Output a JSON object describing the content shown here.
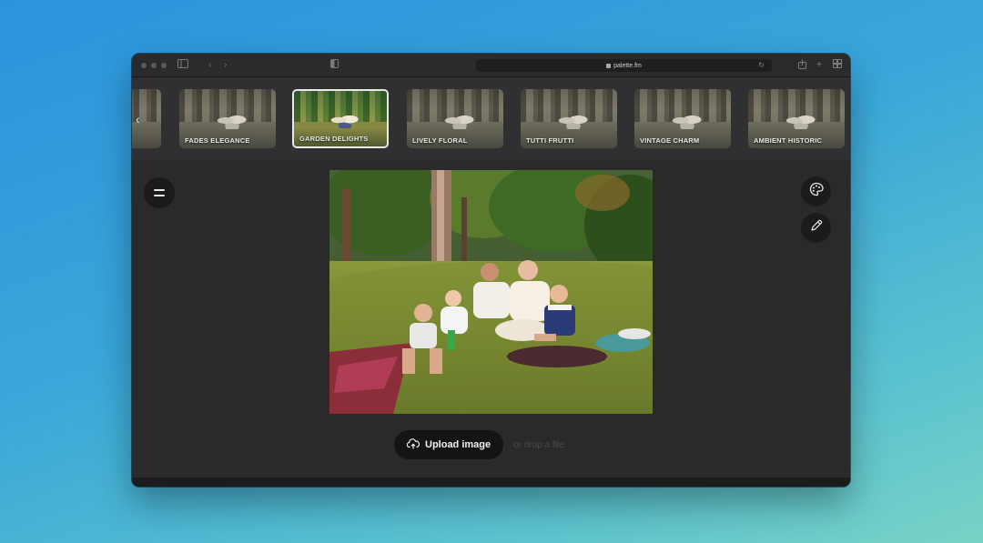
{
  "browser": {
    "url": "palette.fm"
  },
  "filters": [
    {
      "label": "FADES ELEGANCE"
    },
    {
      "label": "GARDEN DELIGHTS",
      "selected": true
    },
    {
      "label": "LIVELY FLORAL"
    },
    {
      "label": "TUTTI FRUTTI"
    },
    {
      "label": "VINTAGE CHARM"
    },
    {
      "label": "AMBIENT HISTORIC"
    }
  ],
  "actions": {
    "upload_label": "Upload image",
    "drop_hint": "or drop a file"
  },
  "icons": {
    "menu": "hamburger-icon",
    "palette": "palette-icon",
    "edit": "pencil-icon",
    "upload": "cloud-upload-icon",
    "prev": "chevron-left-icon"
  },
  "colors": {
    "window_bg": "#2a2a2b",
    "button_bg": "#1b1b1c",
    "selected_border": "#e9e9e9"
  }
}
